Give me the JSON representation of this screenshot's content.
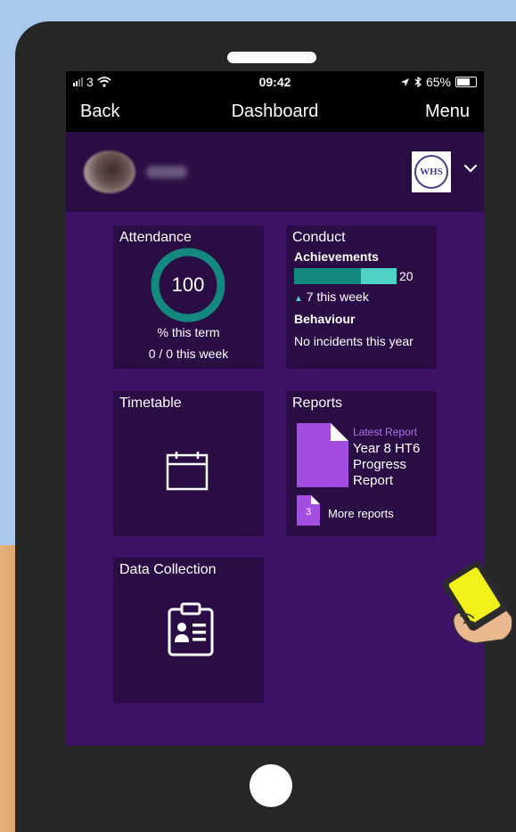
{
  "status_bar": {
    "carrier": "3",
    "time": "09:42",
    "battery_percent": "65%"
  },
  "nav": {
    "back_label": "Back",
    "title": "Dashboard",
    "menu_label": "Menu"
  },
  "school_logo": {
    "text": "WHS"
  },
  "tiles": {
    "attendance": {
      "title": "Attendance",
      "percent_value": "100",
      "ring_fraction": 1.0,
      "term_label": "% this term",
      "week_label": "0 / 0 this week"
    },
    "conduct": {
      "title": "Conduct",
      "achievements_label": "Achievements",
      "achievements_total": "20",
      "achievements_total_value": 20,
      "achievements_week_value": 7,
      "achievements_week_label": "7 this week",
      "behaviour_label": "Behaviour",
      "behaviour_text": "No incidents this year"
    },
    "timetable": {
      "title": "Timetable"
    },
    "reports": {
      "title": "Reports",
      "latest_label": "Latest Report",
      "latest_title": "Year 8 HT6 Progress Report",
      "more_count": "3",
      "more_label": "More reports"
    },
    "data_collection": {
      "title": "Data Collection"
    }
  },
  "colors": {
    "screen_bg": "#3d1266",
    "tile_bg": "#2a0d45",
    "ring": "#13897d",
    "achievements_bar": "#13897d",
    "achievements_bar_light": "#4fd1c5",
    "report_doc": "#a34de0",
    "latest_label": "#b06ee8"
  },
  "icons": {
    "signal": "signal-icon",
    "wifi": "wifi-icon",
    "location": "location-arrow-icon",
    "bluetooth": "bluetooth-icon",
    "battery": "battery-icon",
    "chevron": "chevron-down-icon",
    "calendar": "calendar-icon",
    "report": "document-icon",
    "clipboard": "clipboard-icon"
  }
}
